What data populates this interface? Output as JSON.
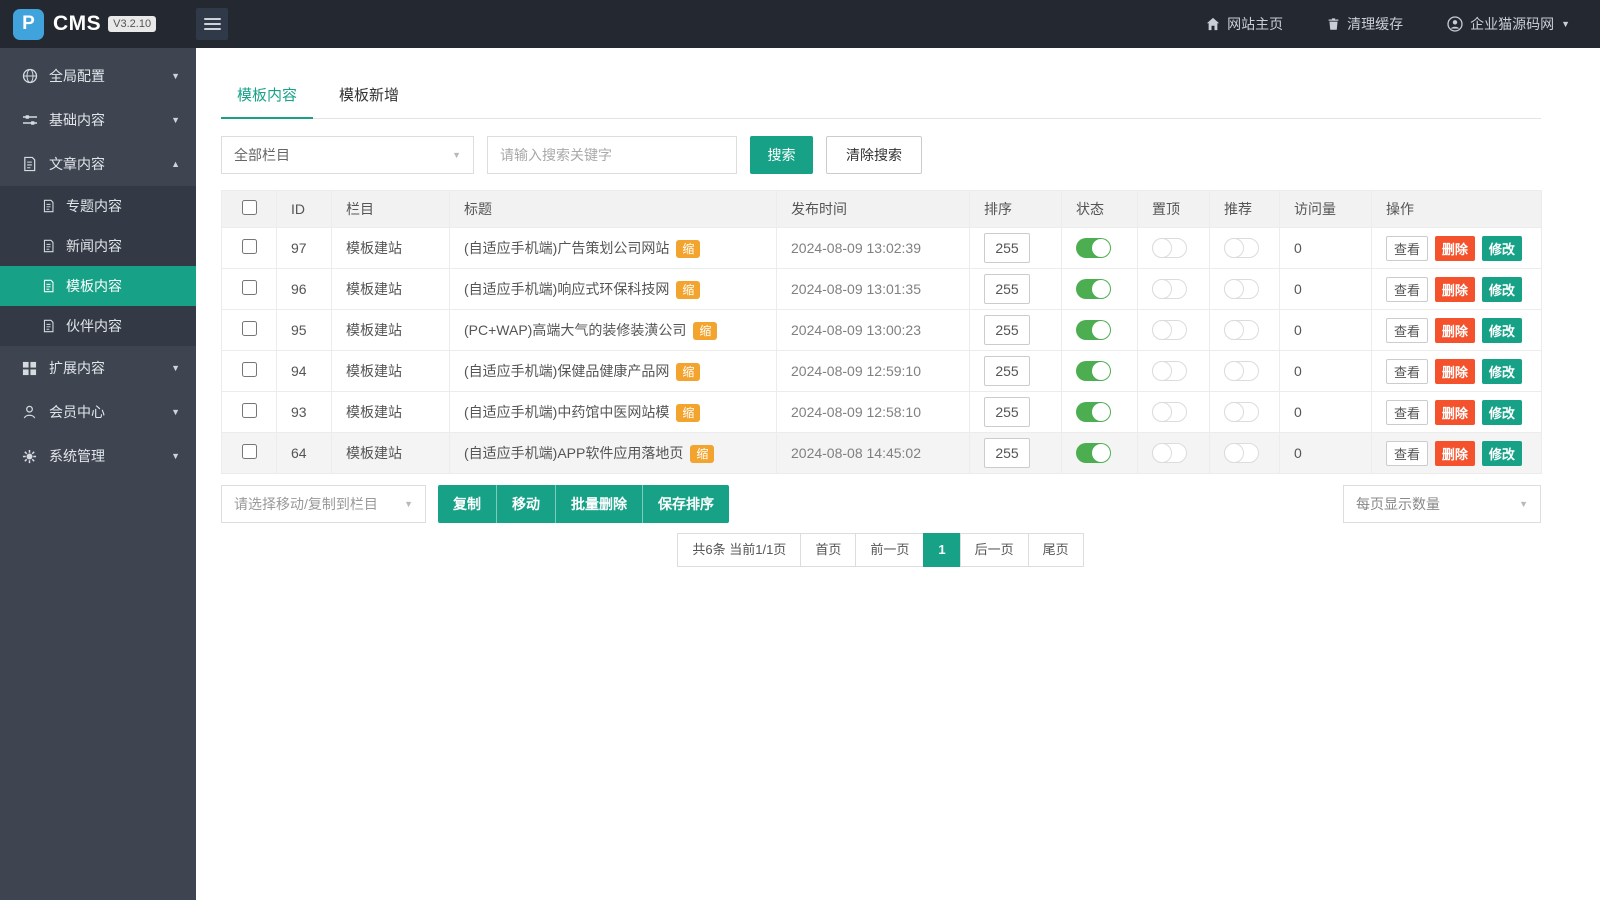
{
  "topbar": {
    "logo_letter": "P",
    "logo_text": "CMS",
    "version": "V3.2.10",
    "nav": [
      {
        "label": "网站主页",
        "icon": "home-icon"
      },
      {
        "label": "清理缓存",
        "icon": "trash-icon"
      },
      {
        "label": "企业猫源码网",
        "icon": "user-icon"
      }
    ]
  },
  "sidebar": {
    "items": [
      {
        "label": "全局配置"
      },
      {
        "label": "基础内容"
      },
      {
        "label": "文章内容",
        "expanded": true
      },
      {
        "label": "扩展内容"
      },
      {
        "label": "会员中心"
      },
      {
        "label": "系统管理"
      }
    ],
    "submenu": [
      {
        "label": "专题内容"
      },
      {
        "label": "新闻内容"
      },
      {
        "label": "模板内容",
        "active": true
      },
      {
        "label": "伙伴内容"
      }
    ]
  },
  "tabs": [
    {
      "label": "模板内容",
      "active": true
    },
    {
      "label": "模板新增"
    }
  ],
  "filter": {
    "category_select": "全部栏目",
    "search_placeholder": "请输入搜索关键字",
    "search_button": "搜索",
    "clear_button": "清除搜索"
  },
  "table": {
    "headers": [
      "ID",
      "栏目",
      "标题",
      "发布时间",
      "排序",
      "状态",
      "置顶",
      "推荐",
      "访问量",
      "操作"
    ],
    "actions": {
      "view": "查看",
      "delete": "删除",
      "edit": "修改"
    },
    "rows": [
      {
        "id": "97",
        "category": "模板建站",
        "title": "(自适应手机端)广告策划公司网站",
        "badge": "缩",
        "date": "2024-08-09 13:02:39",
        "sort": "255",
        "visits": "0"
      },
      {
        "id": "96",
        "category": "模板建站",
        "title": "(自适应手机端)响应式环保科技网",
        "badge": "缩",
        "date": "2024-08-09 13:01:35",
        "sort": "255",
        "visits": "0"
      },
      {
        "id": "95",
        "category": "模板建站",
        "title": "(PC+WAP)高端大气的装修装潢公司",
        "badge": "缩",
        "date": "2024-08-09 13:00:23",
        "sort": "255",
        "visits": "0"
      },
      {
        "id": "94",
        "category": "模板建站",
        "title": "(自适应手机端)保健品健康产品网",
        "badge": "缩",
        "date": "2024-08-09 12:59:10",
        "sort": "255",
        "visits": "0"
      },
      {
        "id": "93",
        "category": "模板建站",
        "title": "(自适应手机端)中药馆中医网站模",
        "badge": "缩",
        "date": "2024-08-09 12:58:10",
        "sort": "255",
        "visits": "0"
      },
      {
        "id": "64",
        "category": "模板建站",
        "title": "(自适应手机端)APP软件应用落地页",
        "badge": "缩",
        "date": "2024-08-08 14:45:02",
        "sort": "255",
        "visits": "0"
      }
    ]
  },
  "batch": {
    "select_placeholder": "请选择移动/复制到栏目",
    "buttons": [
      "复制",
      "移动",
      "批量删除",
      "保存排序"
    ],
    "page_size_select": "每页显示数量"
  },
  "pagination": {
    "info": "共6条 当前1/1页",
    "first": "首页",
    "prev": "前一页",
    "current": "1",
    "next": "后一页",
    "last": "尾页"
  },
  "colors": {
    "accent": "#17a288",
    "danger": "#f4522d",
    "badge": "#f2a42e",
    "toggle_on": "#4cae50",
    "topbar_bg": "#232831",
    "sidebar_bg": "#3e4551"
  }
}
